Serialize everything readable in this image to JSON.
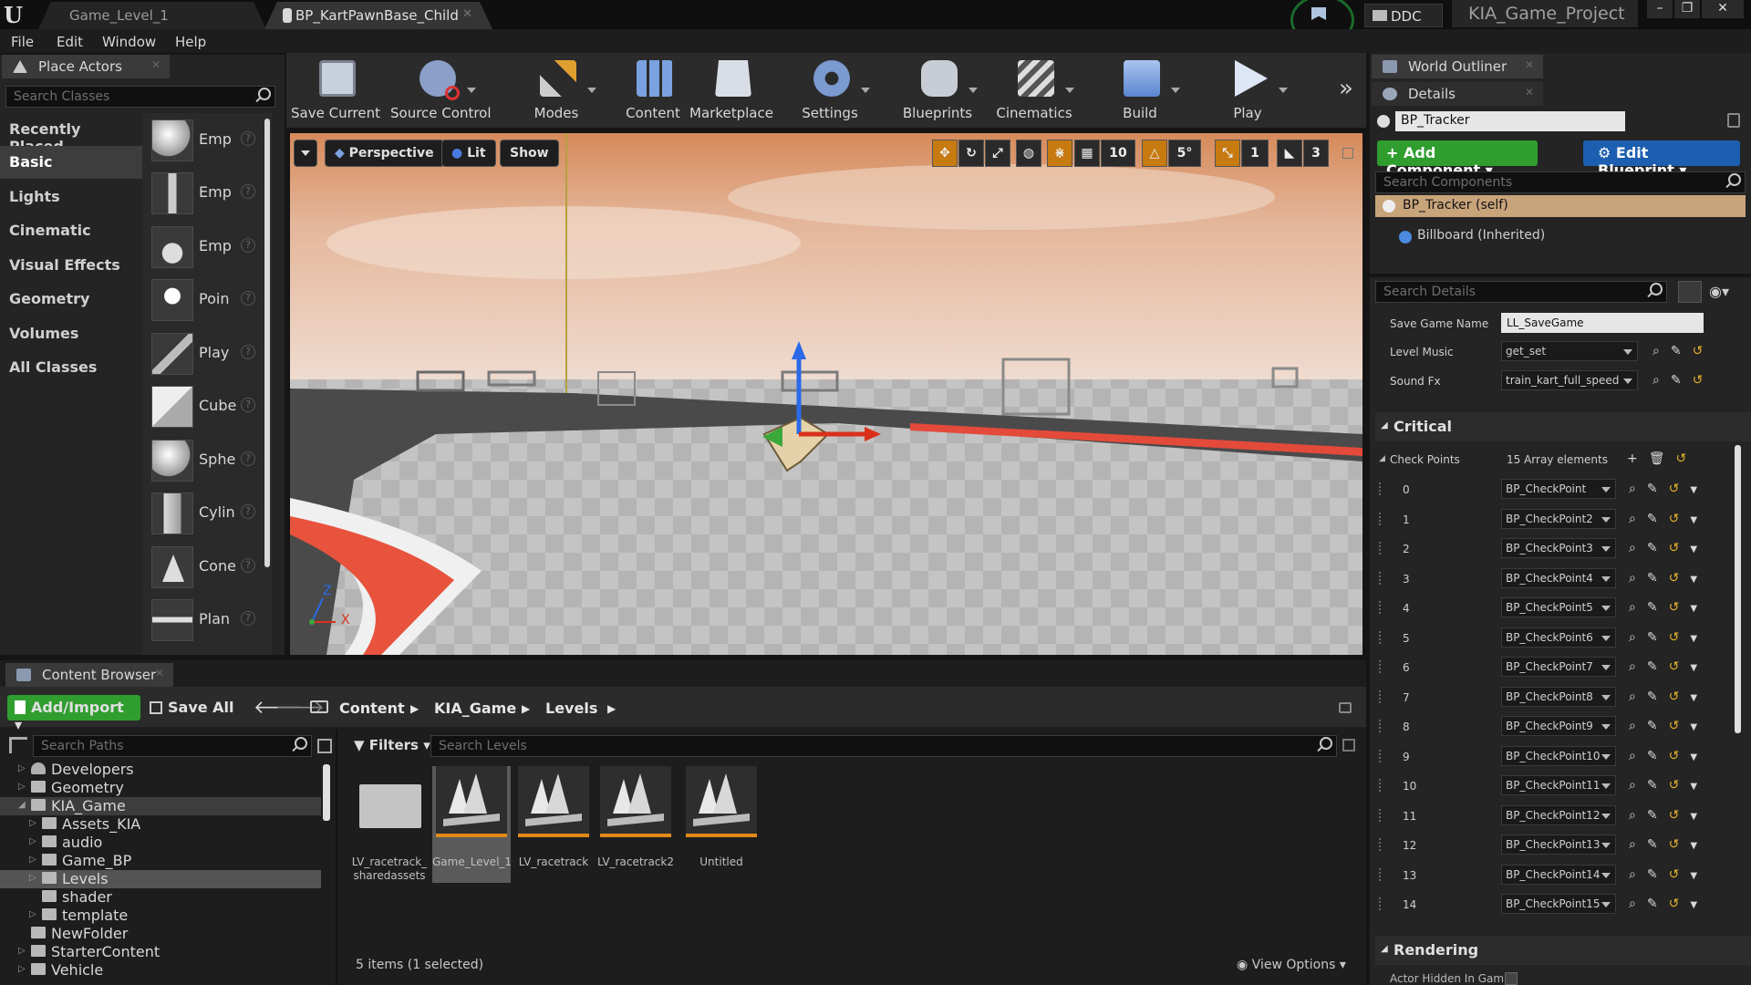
{
  "titlebar": {
    "tabs": [
      {
        "label": "Game_Level_1",
        "active": false
      },
      {
        "label": "BP_KartPawnBase_Child",
        "active": true
      }
    ],
    "ddc_label": "DDC",
    "project_name": "KIA_Game_Project"
  },
  "menu": [
    "File",
    "Edit",
    "Window",
    "Help"
  ],
  "place_actors": {
    "tab_label": "Place Actors",
    "search_placeholder": "Search Classes",
    "categories": [
      "Recently Placed",
      "Basic",
      "Lights",
      "Cinematic",
      "Visual Effects",
      "Geometry",
      "Volumes",
      "All Classes"
    ],
    "selected_category": "Basic",
    "items": [
      "Emp",
      "Emp",
      "Emp",
      "Poin",
      "Play",
      "Cube",
      "Sphe",
      "Cylin",
      "Cone",
      "Plan"
    ],
    "help_glyph": "?"
  },
  "toolbar": {
    "buttons": [
      {
        "label": "Save Current",
        "icon": "save-icon"
      },
      {
        "label": "Source Control",
        "icon": "source-control-icon"
      },
      {
        "label": "Modes",
        "icon": "modes-icon"
      },
      {
        "label": "Content",
        "icon": "content-icon"
      },
      {
        "label": "Marketplace",
        "icon": "marketplace-icon"
      },
      {
        "label": "Settings",
        "icon": "settings-icon"
      },
      {
        "label": "Blueprints",
        "icon": "blueprints-icon"
      },
      {
        "label": "Cinematics",
        "icon": "cinematics-icon"
      },
      {
        "label": "Build",
        "icon": "build-icon"
      },
      {
        "label": "Play",
        "icon": "play-icon"
      }
    ],
    "more": "»"
  },
  "viewport": {
    "perspective_label": "Perspective",
    "lit_label": "Lit",
    "show_label": "Show",
    "grid_snap": "10",
    "rot_snap": "5°",
    "scale_snap": "1",
    "camera_speed": "3",
    "axis_x": "X",
    "axis_z": "Z"
  },
  "content_browser": {
    "tab_label": "Content Browser",
    "add_import_label": "Add/Import",
    "save_all_label": "Save All",
    "breadcrumb": [
      "Content",
      "KIA_Game",
      "Levels"
    ],
    "search_paths_placeholder": "Search Paths",
    "filters_label": "Filters",
    "search_assets_placeholder": "Search Levels",
    "tree": [
      "Developers",
      "Geometry",
      "KIA_Game",
      "Assets_KIA",
      "audio",
      "Game_BP",
      "Levels",
      "shader",
      "template",
      "NewFolder",
      "StarterContent",
      "Vehicle"
    ],
    "assets": [
      {
        "label": "LV_racetrack_ sharedassets",
        "type": "folder"
      },
      {
        "label": "Game_Level_1",
        "type": "level"
      },
      {
        "label": "LV_racetrack",
        "type": "level"
      },
      {
        "label": "LV_racetrack2",
        "type": "level"
      },
      {
        "label": "Untitled",
        "type": "level"
      }
    ],
    "status": "5 items (1 selected)",
    "view_options_label": "View Options"
  },
  "outliner": {
    "tab_label": "World Outliner"
  },
  "details": {
    "tab_label": "Details",
    "actor_name": "BP_Tracker",
    "add_component_label": "Add Component",
    "edit_blueprint_label": "Edit Blueprint",
    "search_components_placeholder": "Search Components",
    "components": [
      "BP_Tracker (self)",
      "Billboard (Inherited)"
    ],
    "search_details_placeholder": "Search Details",
    "properties": [
      {
        "label": "Save Game Name",
        "value": "LL_SaveGame"
      },
      {
        "label": "Level Music",
        "value": "get_set"
      },
      {
        "label": "Sound Fx",
        "value": "train_kart_full_speed"
      }
    ],
    "critical_section": "Critical",
    "check_points_label": "Check Points",
    "check_points_count": "15 Array elements",
    "check_points": [
      {
        "index": "0",
        "value": "BP_CheckPoint"
      },
      {
        "index": "1",
        "value": "BP_CheckPoint2"
      },
      {
        "index": "2",
        "value": "BP_CheckPoint3"
      },
      {
        "index": "3",
        "value": "BP_CheckPoint4"
      },
      {
        "index": "4",
        "value": "BP_CheckPoint5"
      },
      {
        "index": "5",
        "value": "BP_CheckPoint6"
      },
      {
        "index": "6",
        "value": "BP_CheckPoint7"
      },
      {
        "index": "7",
        "value": "BP_CheckPoint8"
      },
      {
        "index": "8",
        "value": "BP_CheckPoint9"
      },
      {
        "index": "9",
        "value": "BP_CheckPoint10"
      },
      {
        "index": "10",
        "value": "BP_CheckPoint11"
      },
      {
        "index": "11",
        "value": "BP_CheckPoint12"
      },
      {
        "index": "12",
        "value": "BP_CheckPoint13"
      },
      {
        "index": "13",
        "value": "BP_CheckPoint14"
      },
      {
        "index": "14",
        "value": "BP_CheckPoint15"
      }
    ],
    "rendering_section": "Rendering",
    "actor_hidden_label": "Actor Hidden In Gam"
  },
  "colors": {
    "accent_orange": "#e08a1a",
    "add_green": "#2f9e2f",
    "edit_blue": "#1c5fb0",
    "selection_tan": "#c8a47a"
  }
}
